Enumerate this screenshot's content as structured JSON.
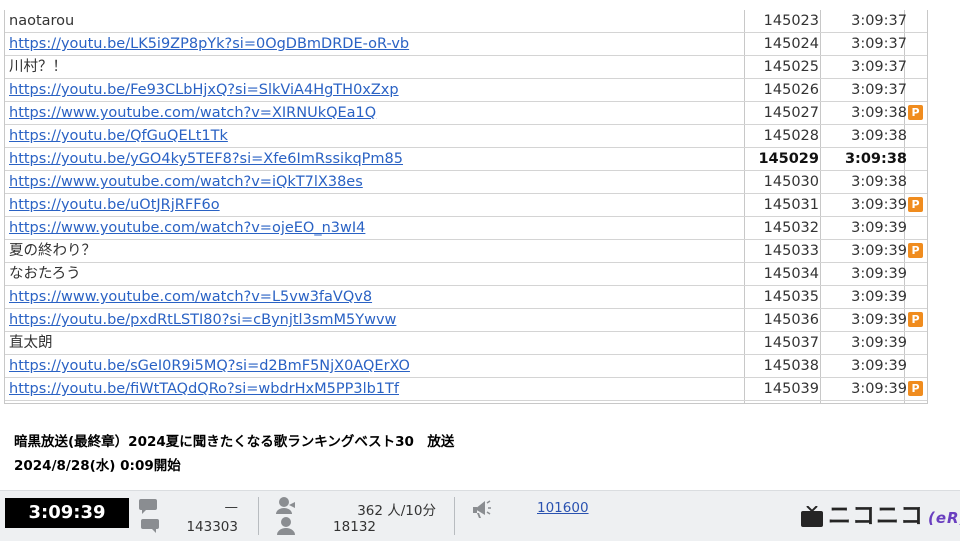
{
  "comments": [
    {
      "text": "naotarou",
      "link": false,
      "no": "145023",
      "time": "3:09:37",
      "premium": false,
      "bold": false
    },
    {
      "text": "https://youtu.be/LK5i9ZP8pYk?si=0OgDBmDRDE-oR-vb",
      "link": true,
      "no": "145024",
      "time": "3:09:37",
      "premium": false,
      "bold": false
    },
    {
      "text": "川村？！",
      "link": false,
      "no": "145025",
      "time": "3:09:37",
      "premium": false,
      "bold": false
    },
    {
      "text": "https://youtu.be/Fe93CLbHjxQ?si=SlkViA4HgTH0xZxp",
      "link": true,
      "no": "145026",
      "time": "3:09:37",
      "premium": false,
      "bold": false
    },
    {
      "text": "https://www.youtube.com/watch?v=XIRNUkQEa1Q",
      "link": true,
      "no": "145027",
      "time": "3:09:38",
      "premium": true,
      "bold": false
    },
    {
      "text": "https://youtu.be/QfGuQELt1Tk",
      "link": true,
      "no": "145028",
      "time": "3:09:38",
      "premium": false,
      "bold": false
    },
    {
      "text": "https://youtu.be/yGO4ky5TEF8?si=Xfe6ImRssikqPm85",
      "link": true,
      "no": "145029",
      "time": "3:09:38",
      "premium": false,
      "bold": true
    },
    {
      "text": "https://www.youtube.com/watch?v=iQkT7lX38es",
      "link": true,
      "no": "145030",
      "time": "3:09:38",
      "premium": false,
      "bold": false
    },
    {
      "text": "https://youtu.be/uOtJRjRFF6o",
      "link": true,
      "no": "145031",
      "time": "3:09:39",
      "premium": true,
      "bold": false
    },
    {
      "text": "https://www.youtube.com/watch?v=ojeEO_n3wI4",
      "link": true,
      "no": "145032",
      "time": "3:09:39",
      "premium": false,
      "bold": false
    },
    {
      "text": "夏の終わり？",
      "link": false,
      "no": "145033",
      "time": "3:09:39",
      "premium": true,
      "bold": false
    },
    {
      "text": "なおたろう",
      "link": false,
      "no": "145034",
      "time": "3:09:39",
      "premium": false,
      "bold": false
    },
    {
      "text": "https://www.youtube.com/watch?v=L5vw3faVQv8",
      "link": true,
      "no": "145035",
      "time": "3:09:39",
      "premium": false,
      "bold": false
    },
    {
      "text": "https://youtu.be/pxdRtLSTI80?si=cBynjtl3smM5Ywvw",
      "link": true,
      "no": "145036",
      "time": "3:09:39",
      "premium": true,
      "bold": false
    },
    {
      "text": "直太朗",
      "link": false,
      "no": "145037",
      "time": "3:09:39",
      "premium": false,
      "bold": false
    },
    {
      "text": "https://youtu.be/sGeI0R9i5MQ?si=d2BmF5NjX0AQErXO",
      "link": true,
      "no": "145038",
      "time": "3:09:39",
      "premium": false,
      "bold": false
    },
    {
      "text": "https://youtu.be/fiWtTAQdQRo?si=wbdrHxM5PP3lb1Tf",
      "link": true,
      "no": "145039",
      "time": "3:09:39",
      "premium": true,
      "bold": false
    }
  ],
  "premium_badge": "P",
  "program": {
    "title": "暗黒放送(最終章）2024夏に聞きたくなる歌ランキングベスト30　放送",
    "start": "2024/8/28(水) 0:09開始"
  },
  "status": {
    "elapsed": "3:09:39",
    "comment_rate": "—",
    "comment_total": "143303",
    "viewers_rate": "362 人/10分",
    "viewers_total": "18132",
    "ad_link": "101600"
  },
  "logo": {
    "text": "ニコニコ",
    "suffix": "(eR)"
  },
  "colors": {
    "link": "#2a62c4",
    "premium": "#f08c1e",
    "time_box": "#000000",
    "statusbar": "#eef0f2"
  },
  "icons": {
    "comment": "speech-bubble-icon",
    "viewers": "person-icon",
    "ad": "megaphone-icon",
    "logo": "tv-icon"
  }
}
